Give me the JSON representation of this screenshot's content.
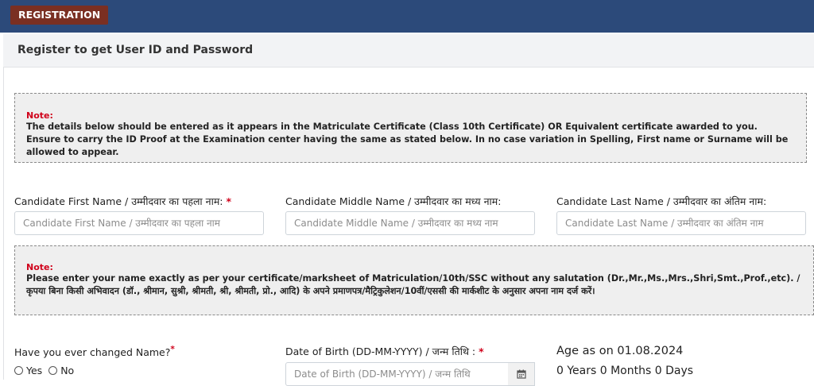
{
  "header": {
    "badge": "REGISTRATION"
  },
  "panel": {
    "title": "Register to get User ID and Password"
  },
  "note1": {
    "label": "Note:",
    "text": "The details below should be entered as it appears in the Matriculate Certificate (Class 10th Certificate) OR Equivalent certificate awarded to you. Ensure to carry the ID Proof at the Examination center having the same as stated below. In no case variation in Spelling, First name or Surname will be allowed to appear."
  },
  "fields": {
    "first_name": {
      "label": "Candidate First Name / उम्मीदवार का पहला नाम:",
      "required": "*",
      "placeholder": "Candidate First Name / उम्मीदवार का पहला नाम"
    },
    "middle_name": {
      "label": "Candidate Middle Name / उम्मीदवार का मध्य नाम:",
      "placeholder": "Candidate Middle Name / उम्मीदवार का मध्य नाम"
    },
    "last_name": {
      "label": "Candidate Last Name / उम्मीदवार का अंतिम नाम:",
      "placeholder": "Candidate Last Name / उम्मीदवार का अंतिम नाम"
    },
    "changed_name": {
      "label": "Have you ever changed Name?",
      "required": "*",
      "options": [
        "Yes",
        "No"
      ]
    },
    "dob": {
      "label": "Date of Birth (DD-MM-YYYY) / जन्म तिथि :",
      "required": "*",
      "placeholder": "Date of Birth (DD-MM-YYYY) / जन्म तिथि"
    }
  },
  "note2": {
    "label": "Note:",
    "text": "Please enter your name exactly as per your certificate/marksheet of Matriculation/10th/SSC without any salutation (Dr.,Mr.,Ms.,Mrs.,Shri,Smt.,Prof.,etc). / कृपया बिना किसी अभिवादन (डॉ., श्रीमान, सुश्री, श्रीमती, श्री, श्रीमती, प्रो., आदि) के अपने प्रमाणपत्र/मैट्रिकुलेशन/10वीं/एससी की मार्कशीट के अनुसार अपना नाम दर्ज करें।"
  },
  "age": {
    "title": "Age as on 01.08.2024",
    "value": "0 Years 0 Months 0 Days"
  },
  "colors": {
    "header": "#2c4a7a",
    "badge": "#7a2f22",
    "required": "#d0021b"
  },
  "icons": {
    "calendar": "calendar-icon"
  }
}
